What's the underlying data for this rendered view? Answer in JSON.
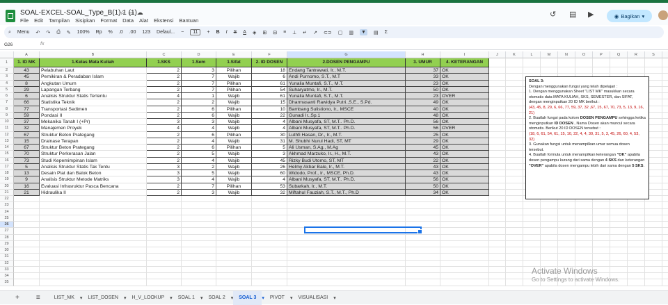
{
  "app": {
    "title": "SOAL-EXCEL-SOAL_Type_B(1) 1 (1)",
    "menus": [
      "File",
      "Edit",
      "Tampilan",
      "Sisipkan",
      "Format",
      "Data",
      "Alat",
      "Ekstensi",
      "Bantuan"
    ],
    "share_label": "Bagikan"
  },
  "toolbar": {
    "search_label": "Menu",
    "zoom": "100%",
    "currency": "Rp",
    "percent": "%",
    "dec_less": ".0",
    "dec_more": ".00",
    "number_format": "123",
    "font": "Defaul...",
    "font_size": "11",
    "bold": "B",
    "italic": "I",
    "strike": "S",
    "text_color": "A"
  },
  "formula_bar": {
    "cell_ref": "G26",
    "fx": "fx",
    "content": ""
  },
  "grid": {
    "columns": [
      "A",
      "B",
      "C",
      "D",
      "E",
      "F",
      "G",
      "H",
      "I",
      "J",
      "K",
      "L",
      "M",
      "N",
      "O",
      "P",
      "Q",
      "R",
      "S",
      "T"
    ],
    "selected_column": "G",
    "row_numbers": [
      "1",
      "2",
      "3",
      "4",
      "5",
      "6",
      "7",
      "8",
      "9",
      "10",
      "11",
      "12",
      "13",
      "14",
      "15",
      "16",
      "17",
      "18",
      "19",
      "20",
      "21",
      "22",
      "23",
      "24",
      "25",
      "26",
      "27",
      "28",
      "29",
      "30",
      "31",
      "32",
      "33",
      "34",
      "35"
    ],
    "selected_row": "26"
  },
  "table": {
    "headers": [
      "1. ID MK",
      "1.Kelas Mata Kuliah",
      "1.SKS",
      "1.Sem",
      "1.Sifat",
      "2. ID DOSEN",
      "2.DOSEN PENGAMPU",
      "3. UMUR",
      "4. KETERANGAN"
    ],
    "rows": [
      [
        "43",
        "Pelabuhan Laut",
        "2",
        "3",
        "Pilihan",
        "18",
        "Endang Tantrawati, Ir., M.T.",
        "37",
        "OK"
      ],
      [
        "45",
        "Pemikiran & Peradaban Islam",
        "2",
        "7",
        "Wajib",
        "6",
        "Andi Purnomo, S.T., M.T",
        "33",
        "OK"
      ],
      [
        "8",
        "Angkutan Umum",
        "2",
        "7",
        "Pilihan",
        "61",
        "Yunalia Muntafi, S.T., M.T.",
        "23",
        "OK"
      ],
      [
        "29",
        "Lapangan Terbang",
        "2",
        "7",
        "Pilihan",
        "54",
        "Suharyatmo, Ir., M.T.",
        "50",
        "OK"
      ],
      [
        "6",
        "Analisis Struktur Statis Tertentu",
        "4",
        "1",
        "Wajib",
        "61",
        "Yunalia Muntafi, S.T., M.T.",
        "23",
        "OVER"
      ],
      [
        "66",
        "Statistika Teknik",
        "2",
        "2",
        "Wajib",
        "15",
        "Dharmasanti Rawidya Putri.,S.E., S.Pd.",
        "49",
        "OK"
      ],
      [
        "77",
        "Transportasi Sedimen",
        "2",
        "6",
        "Pilihan",
        "10",
        "Bambang Sulistiono, Ir., MSCE",
        "40",
        "OK"
      ],
      [
        "59",
        "Pondasi II",
        "2",
        "6",
        "Wajib",
        "22",
        "Gunadi Ir.,Sp.1",
        "48",
        "OK"
      ],
      [
        "37",
        "Mekanika Tanah I (+Pr)",
        "3",
        "3",
        "Wajib",
        "4",
        "Albani Musyafa,  ST, M.T.. Ph.D.",
        "56",
        "OK"
      ],
      [
        "32",
        "Manajemen Proyek",
        "4",
        "4",
        "Wajib",
        "4",
        "Albani Musyafa,  ST, M.T.. Ph.D.",
        "56",
        "OVER"
      ],
      [
        "67",
        "Struktur Beton Prategang",
        "2",
        "6",
        "Pilihan",
        "30",
        "Luthfi Hasan, Dr., Ir., M.T.",
        "25",
        "OK"
      ],
      [
        "15",
        "Drainase Terapan",
        "2",
        "4",
        "Wajib",
        "31",
        "M. Shubhi Nurul Hadi, ST, MT",
        "29",
        "OK"
      ],
      [
        "67",
        "Struktur Beton Prategang",
        "2",
        "6",
        "Pilihan",
        "5",
        "Ali Usman, S.Ag., M.Ag",
        "45",
        "OK"
      ],
      [
        "70",
        "Struktur Perkerasan Jalan",
        "2",
        "5",
        "Wajib",
        "3",
        "Akhmad Marzuko, Ir., H., M.T.",
        "43",
        "OK"
      ],
      [
        "73",
        "Studi Kepemimpinan Islam",
        "2",
        "4",
        "Wajib",
        "45",
        "Rizky Budi Utomo, ST, MT",
        "22",
        "OK"
      ],
      [
        "5",
        "Analisis Struktur Statis Tak Tentu",
        "3",
        "2",
        "Wajib",
        "26",
        "Helmy Akbar Bale, Ir., M.T.",
        "43",
        "OK"
      ],
      [
        "13",
        "Desain Plat dan Balok Beton",
        "3",
        "5",
        "Wajib",
        "60",
        "Widodo, Prof., Ir., MSCE, Ph.D.",
        "43",
        "OK"
      ],
      [
        "9",
        "Analisis Struktur Metode Matriks",
        "3",
        "4",
        "Wajib",
        "4",
        "Albani Musyafa,  ST, M.T.. Ph.D.",
        "56",
        "OK"
      ],
      [
        "16",
        "Evaluasi Infrasruktur Pasca Bencana",
        "2",
        "7",
        "Pilihan",
        "53",
        "Subarkah, Ir., M.T.",
        "50",
        "OK"
      ],
      [
        "21",
        "Hidraulika II",
        "2",
        "3",
        "Wajib",
        "32",
        "Miftahul Fauziah, S.T., M.T., Ph.D",
        "34",
        "OK"
      ]
    ]
  },
  "soal_box": {
    "title": "SOAL 3:",
    "intro": "Dengan menggunakan fungsi yang telah dipelajari  :",
    "item1": "1. Dengan menggunakan Sheet \"LIST MK\" masukkan secara otomatis data  MATA KULIAH, SKS, SEMESTER, dan SIFAT, dengan menginputkan 20 ID MK berikut :",
    "item1_ids": "(43, 45, 8, 29, 6, 66, 77, 59, 37, 32 ,67, 15, 67, 70, 73, 5, 13, 9, 16, 21)",
    "item2_prefix": "2. Buatlah fungsi pada kolom ",
    "item2_bold": "DOSEN PENGAMPU",
    "item2_mid": " sehingga ketika menginputkan ",
    "item2_bold2": "ID DOSEN",
    "item2_suffix": " , Nama Dosen akan muncul secara otomatis. Berikut 20 ID DOSEN  tersebut :",
    "item2_ids": "(18, 6, 61, 54, 61, 15, 10, 22, 4, 4, 30, 31, 5, 3, 45, 26, 60, 4, 53, 32)",
    "item3": "3. Gunakan fungsi untuk menampilkan  umur  semua dosen tersebut.",
    "item4_a": "4. Buatlah formula untuk menampilkan keterangan ",
    "item4_ok": "\"OK\"",
    "item4_b": " apabila dosen pengampu kurang dari sama dengan ",
    "item4_4sks": "4 SKS",
    "item4_c": " dan keterangan ",
    "item4_over": "\"OVER\"",
    "item4_d": " apabila dosen mengampu lebih dari sama dengan ",
    "item4_5sks": "5 SKS",
    "item4_e": "."
  },
  "watermark": {
    "title": "Activate Windows",
    "subtitle": "Go to Settings to activate Windows."
  },
  "sheet_tabs": {
    "add": "+",
    "all": "≡",
    "tabs": [
      "LIST_MK",
      "LIST_DOSEN",
      "H_V_LOOKUP",
      "SOAL 1",
      "SOAL 2",
      "SOAL 3",
      "PIVOT",
      "VISUALISASI"
    ],
    "active": "SOAL 3"
  },
  "colors": {
    "header_green": "#92d050",
    "grey_cell": "#d9d9d9",
    "accent": "#1a73e8"
  }
}
